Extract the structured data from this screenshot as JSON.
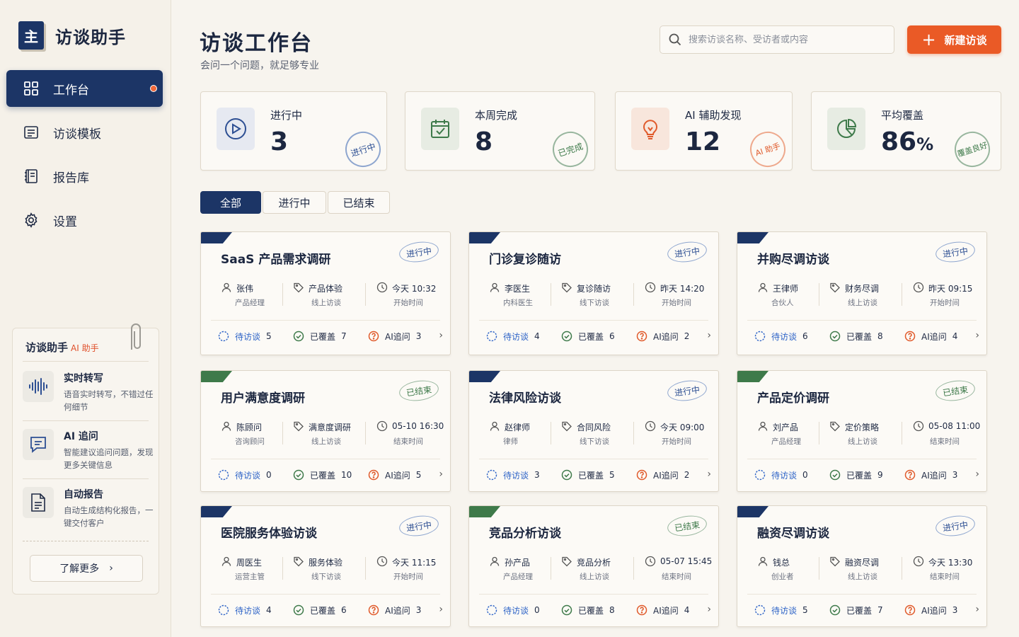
{
  "app": {
    "logo_char": "主",
    "name": "访谈助手"
  },
  "nav": [
    {
      "label": "工作台",
      "icon": "grid-icon",
      "active": true
    },
    {
      "label": "访谈模板",
      "icon": "template-icon",
      "active": false
    },
    {
      "label": "报告库",
      "icon": "book-icon",
      "active": false
    },
    {
      "label": "设置",
      "icon": "gear-icon",
      "active": false
    }
  ],
  "helper": {
    "title": "访谈助手",
    "tag": "AI 助手",
    "features": [
      {
        "name": "实时转写",
        "desc": "语音实时转写，不错过任何细节",
        "icon": "waveform-icon"
      },
      {
        "name": "AI 追问",
        "desc": "智能建议追问问题，发现更多关键信息",
        "icon": "chat-icon"
      },
      {
        "name": "自动报告",
        "desc": "自动生成结构化报告，一键交付客户",
        "icon": "document-icon"
      }
    ],
    "more_label": "了解更多"
  },
  "header": {
    "title": "访谈工作台",
    "subtitle": "会问一个问题，就足够专业",
    "search_placeholder": "搜索访谈名称、受访者或内容",
    "new_label": "新建访谈"
  },
  "stats": [
    {
      "label": "进行中",
      "value": "3",
      "suffix": "",
      "stamp": "进行中",
      "icon": "play-icon",
      "color": "#2d4f93",
      "bg": "#e6e9f1"
    },
    {
      "label": "本周完成",
      "value": "8",
      "suffix": "",
      "stamp": "已完成",
      "icon": "calendar-check-icon",
      "color": "#3e7a4a",
      "bg": "#e7ece3"
    },
    {
      "label": "AI 辅助发现",
      "value": "12",
      "suffix": "",
      "stamp": "AI 助手",
      "icon": "bulb-icon",
      "color": "#e05a2b",
      "bg": "#f8e6dc"
    },
    {
      "label": "平均覆盖",
      "value": "86",
      "suffix": "%",
      "stamp": "覆盖良好",
      "icon": "pie-icon",
      "color": "#3e7a4a",
      "bg": "#e7ece3"
    }
  ],
  "tabs": [
    "全部",
    "进行中",
    "已结束"
  ],
  "labels": {
    "pending": "待访谈",
    "covered": "已覆盖",
    "ai": "AI追问"
  },
  "cards": [
    {
      "title": "SaaS 产品需求调研",
      "status": "进行中",
      "person": "张伟",
      "role": "产品经理",
      "topic": "产品体验",
      "mode": "线上访谈",
      "time": "今天 10:32",
      "time_label": "开始时间",
      "pending": "5",
      "covered": "7",
      "ai": "3"
    },
    {
      "title": "门诊复诊随访",
      "status": "进行中",
      "person": "李医生",
      "role": "内科医生",
      "topic": "复诊随访",
      "mode": "线下访谈",
      "time": "昨天 14:20",
      "time_label": "开始时间",
      "pending": "4",
      "covered": "6",
      "ai": "2"
    },
    {
      "title": "并购尽调访谈",
      "status": "进行中",
      "person": "王律师",
      "role": "合伙人",
      "topic": "财务尽调",
      "mode": "线上访谈",
      "time": "昨天 09:15",
      "time_label": "开始时间",
      "pending": "6",
      "covered": "8",
      "ai": "4"
    },
    {
      "title": "用户满意度调研",
      "status": "已结束",
      "person": "陈顾问",
      "role": "咨询顾问",
      "topic": "满意度调研",
      "mode": "线上访谈",
      "time": "05-10 16:30",
      "time_label": "结束时间",
      "pending": "0",
      "covered": "10",
      "ai": "5"
    },
    {
      "title": "法律风险访谈",
      "status": "进行中",
      "person": "赵律师",
      "role": "律师",
      "topic": "合同风险",
      "mode": "线下访谈",
      "time": "今天 09:00",
      "time_label": "开始时间",
      "pending": "3",
      "covered": "5",
      "ai": "2"
    },
    {
      "title": "产品定价调研",
      "status": "已结束",
      "person": "刘产品",
      "role": "产品经理",
      "topic": "定价策略",
      "mode": "线上访谈",
      "time": "05-08 11:00",
      "time_label": "结束时间",
      "pending": "0",
      "covered": "9",
      "ai": "3"
    },
    {
      "title": "医院服务体验访谈",
      "status": "进行中",
      "person": "周医生",
      "role": "运营主管",
      "topic": "服务体验",
      "mode": "线下访谈",
      "time": "今天 11:15",
      "time_label": "开始时间",
      "pending": "4",
      "covered": "6",
      "ai": "3"
    },
    {
      "title": "竞品分析访谈",
      "status": "已结束",
      "person": "孙产品",
      "role": "产品经理",
      "topic": "竞品分析",
      "mode": "线上访谈",
      "time": "05-07 15:45",
      "time_label": "结束时间",
      "pending": "0",
      "covered": "8",
      "ai": "4"
    },
    {
      "title": "融资尽调访谈",
      "status": "进行中",
      "person": "钱总",
      "role": "创业者",
      "topic": "融资尽调",
      "mode": "线上访谈",
      "time": "今天 13:30",
      "time_label": "结束时间",
      "pending": "5",
      "covered": "7",
      "ai": "3"
    }
  ],
  "colors": {
    "navy": "#1c3566",
    "green": "#3e7a4a",
    "orange": "#ea5a26",
    "blue": "#2d63c7"
  }
}
